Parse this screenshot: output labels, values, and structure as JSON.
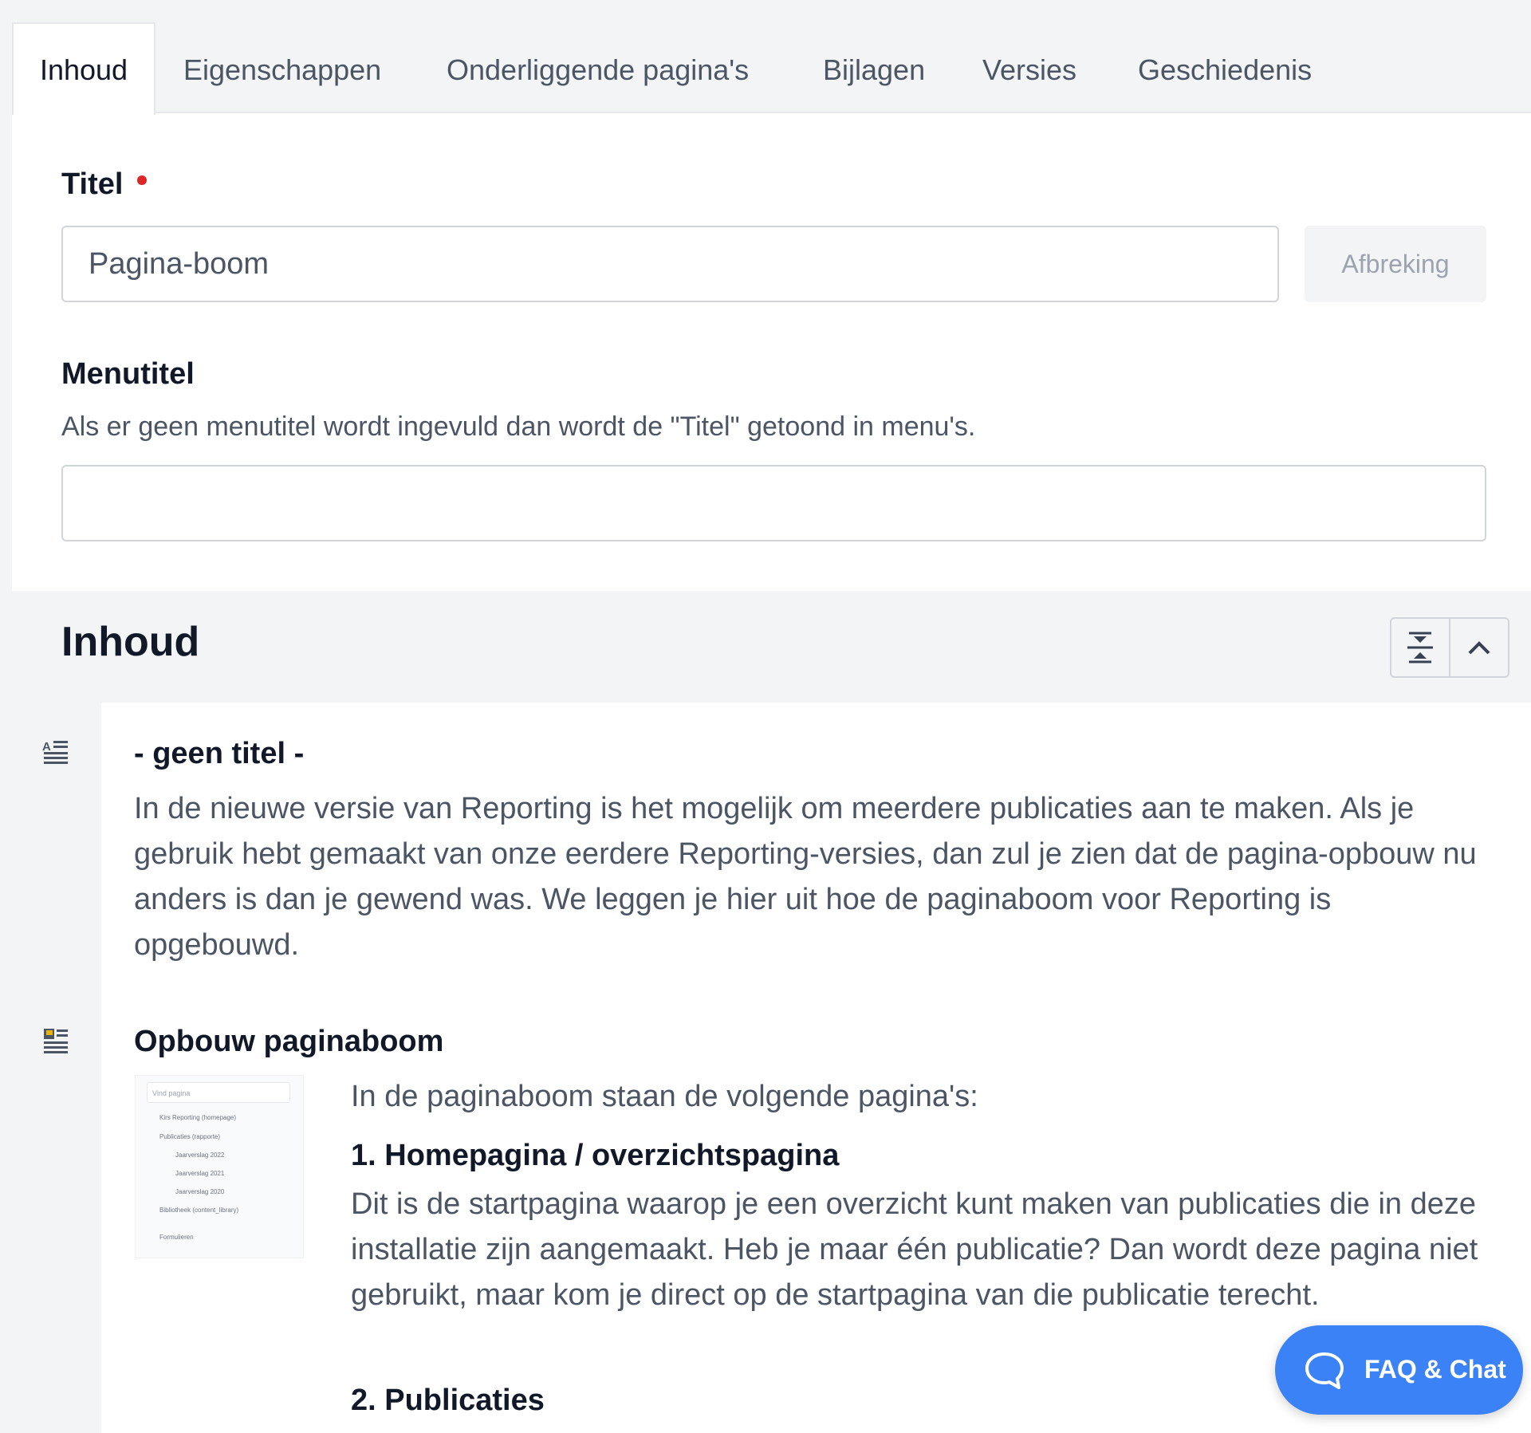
{
  "tabs": [
    {
      "label": "Inhoud",
      "active": true
    },
    {
      "label": "Eigenschappen"
    },
    {
      "label": "Onderliggende pagina's"
    },
    {
      "label": "Bijlagen"
    },
    {
      "label": "Versies"
    },
    {
      "label": "Geschiedenis"
    }
  ],
  "form": {
    "title_label": "Titel",
    "title_value": "Pagina-boom",
    "afbreking_label": "Afbreking",
    "menutitle_label": "Menutitel",
    "menutitle_help": "Als er geen menutitel wordt ingevuld dan wordt de \"Titel\" getoond in menu's.",
    "menutitle_value": ""
  },
  "content": {
    "section_title": "Inhoud",
    "blocks": [
      {
        "title": "- geen titel -",
        "text": "In de nieuwe versie van Reporting is het mogelijk om meerdere publicaties aan te maken. Als je gebruik hebt gemaakt van onze eerdere Reporting-versies, dan zul je zien dat de pagina-opbouw nu anders is dan je gewend was. We leggen je hier uit hoe de paginaboom voor Reporting is opgebouwd.",
        "icon": "text-block-icon"
      },
      {
        "title": "Opbouw paginaboom",
        "icon": "image-text-block-icon",
        "intro": "In de paginaboom staan de volgende pagina's:",
        "item1_heading": "1. Homepagina / overzichtspagina",
        "item1_text": "Dit is de startpagina waarop je een overzicht kunt maken van publicaties die in deze installatie zijn aangemaakt. Heb je maar één publicatie? Dan wordt deze pagina niet gebruikt, maar kom je direct op de startpagina van die publicatie terecht.",
        "item2_heading": "2. Publicaties"
      }
    ]
  },
  "thumbnail": {
    "search_placeholder": "Vind pagina",
    "rows": [
      "Kirs Reporting (homepage)",
      "Publicaties (rapporte)",
      "Jaarverslag 2022",
      "Jaarverslag 2021",
      "Jaarverslag 2020",
      "Bibliotheek (content_library)",
      "Formulieren"
    ]
  },
  "faq": {
    "label": "FAQ & Chat"
  },
  "colors": {
    "accent": "#3b82f6",
    "required": "#dc2626"
  }
}
